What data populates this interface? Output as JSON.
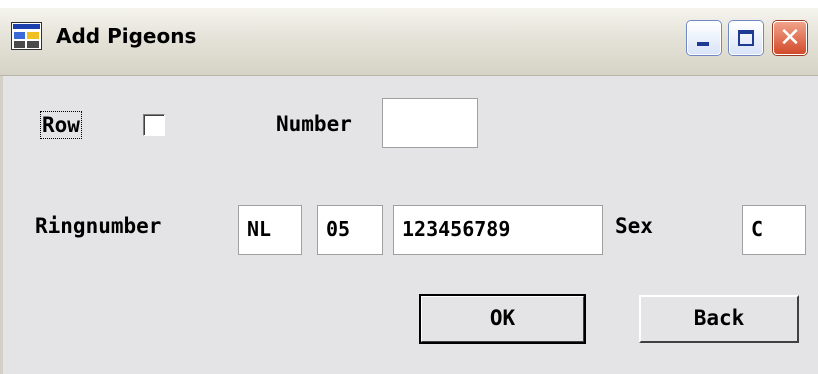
{
  "window": {
    "title": "Add Pigeons",
    "controls": [
      "minimize-icon",
      "maximize-icon",
      "close-icon"
    ],
    "close_glyph": "✕"
  },
  "form": {
    "row_label": "Row",
    "row_checked": false,
    "number_label": "Number",
    "number_value": "",
    "ringnumber_label": "Ringnumber",
    "ring_country": "NL",
    "ring_year": "05",
    "ring_number": "123456789",
    "sex_label": "Sex",
    "sex_value": "C"
  },
  "buttons": {
    "ok_label": "OK",
    "back_label": "Back"
  }
}
